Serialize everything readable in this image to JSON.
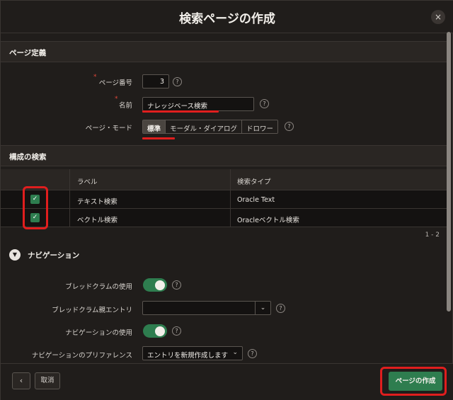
{
  "dialog": {
    "title": "検索ページの作成",
    "close_icon": "×"
  },
  "page_definition": {
    "section_title": "ページ定義",
    "page_number_label": "ページ番号",
    "page_number_value": "3",
    "name_label": "名前",
    "name_value": "ナレッジベース検索",
    "page_mode_label": "ページ・モード",
    "page_modes": [
      "標準",
      "モーダル・ダイアログ",
      "ドロワー"
    ],
    "selected_mode": "標準",
    "help_glyph": "?"
  },
  "search_config": {
    "section_title": "構成の検索",
    "columns": [
      "ラベル",
      "検索タイプ"
    ],
    "rows": [
      {
        "checked": true,
        "label": "テキスト検索",
        "type": "Oracle Text"
      },
      {
        "checked": true,
        "label": "ベクトル検索",
        "type": "Oracleベクトル検索"
      }
    ],
    "row_count": "1 - 2"
  },
  "navigation": {
    "section_title": "ナビゲーション",
    "toggle_icon": "▼",
    "breadcrumb_use_label": "ブレッドクラムの使用",
    "breadcrumb_use_value": true,
    "breadcrumb_parent_label": "ブレッドクラム親エントリ",
    "breadcrumb_parent_value": "",
    "navigation_use_label": "ナビゲーションの使用",
    "navigation_use_value": true,
    "navigation_pref_label": "ナビゲーションのプリファレンス",
    "navigation_pref_value": "エントリを新規作成します",
    "chevron": "⌄"
  },
  "footer": {
    "back_icon": "‹",
    "cancel_label": "取消",
    "create_label": "ページの作成"
  },
  "colors": {
    "accent_green": "#2e7d4f",
    "highlight_red": "#e01e1e",
    "background": "#201d1b"
  }
}
